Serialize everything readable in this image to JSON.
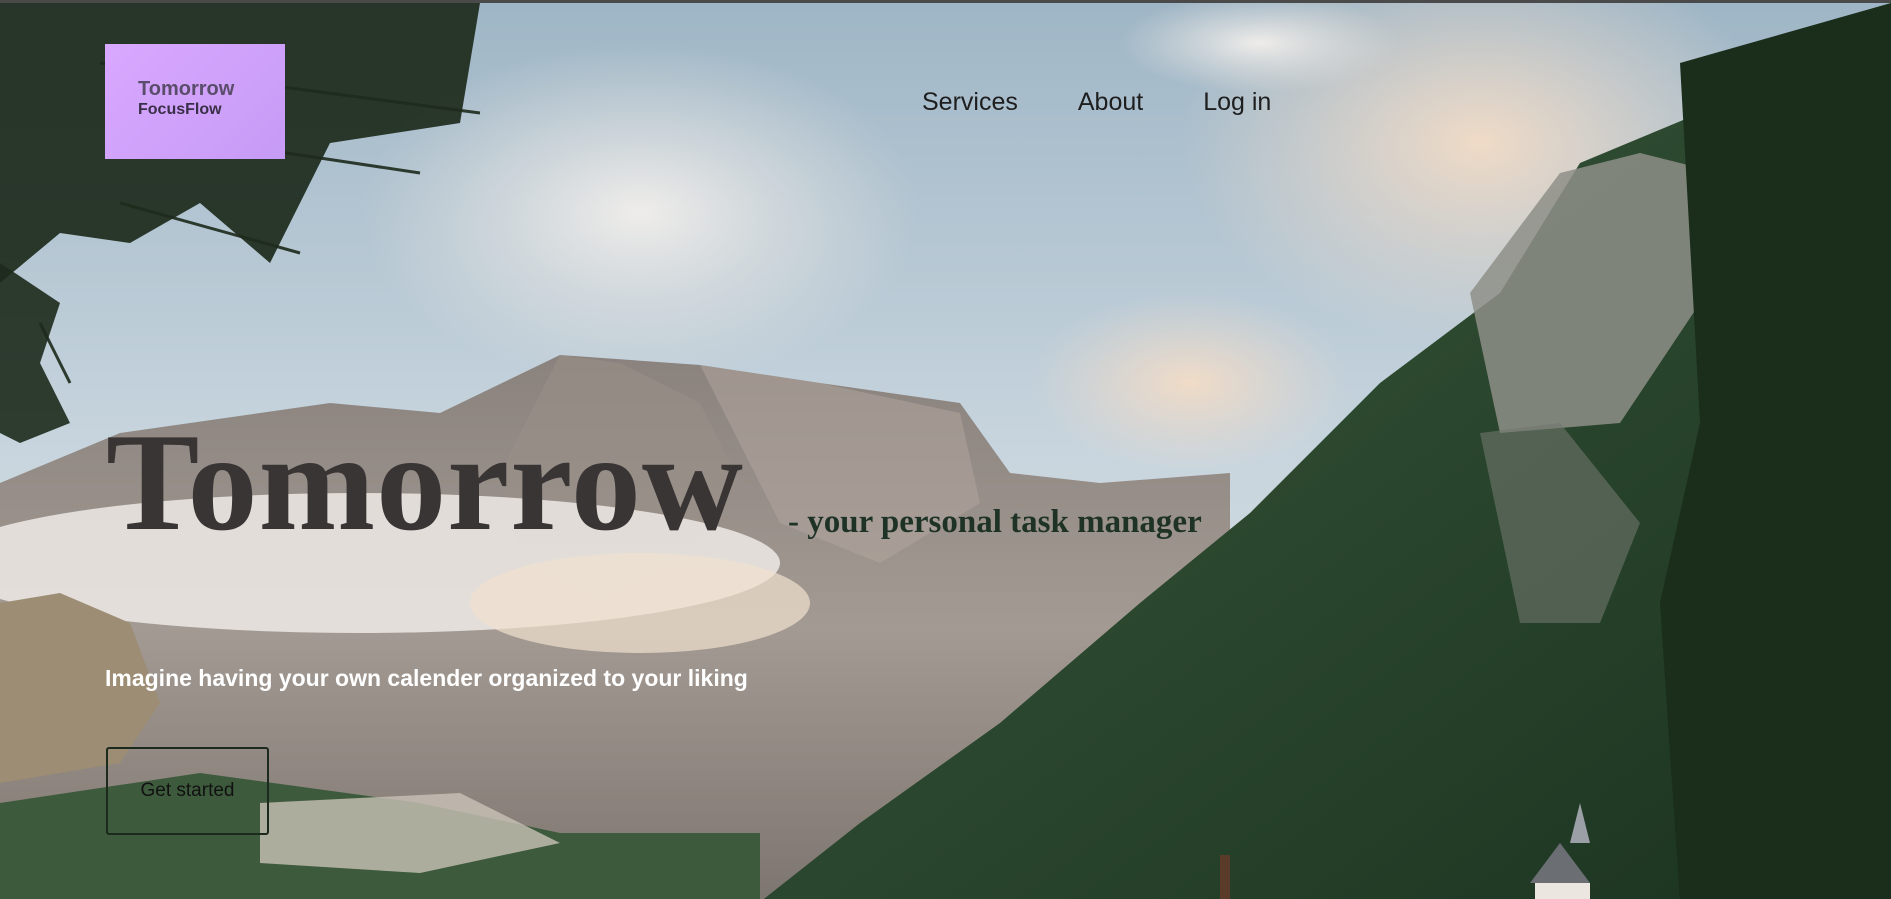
{
  "logo": {
    "title": "Tomorrow",
    "subtitle": "FocusFlow",
    "background": "#d2a4ff"
  },
  "nav": {
    "items": [
      {
        "label": "Services"
      },
      {
        "label": "About"
      },
      {
        "label": "Log in"
      }
    ]
  },
  "hero": {
    "headline": "Tomorrow",
    "tagline": "- your personal task manager",
    "subtext": "Imagine having your own calender organized to your liking",
    "cta_label": "Get started",
    "background_image": "mountain-valley-landscape"
  },
  "colors": {
    "headline": "#3a3535",
    "tagline": "#1e3325",
    "nav_text": "#1e1e1e",
    "subtext": "#ffffff"
  }
}
